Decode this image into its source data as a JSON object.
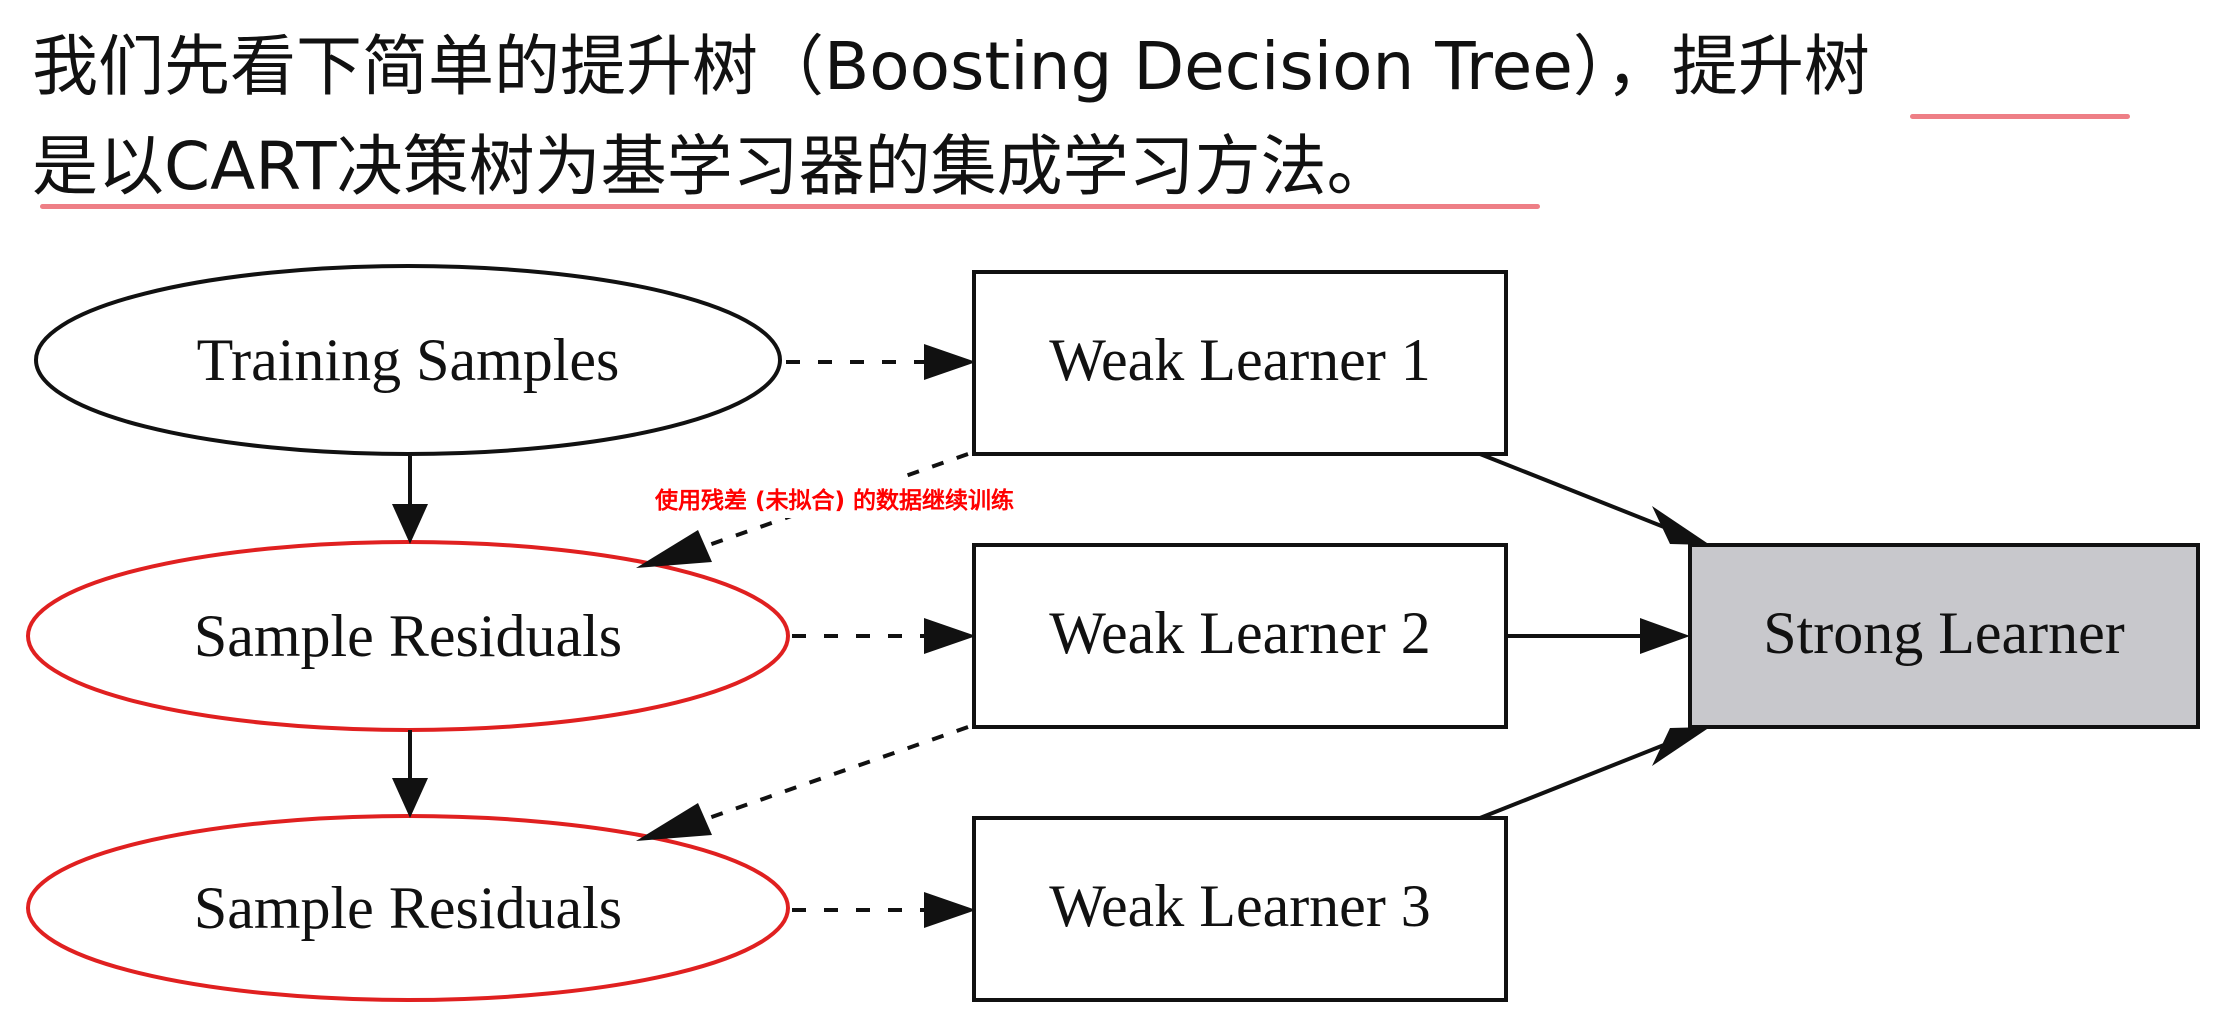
{
  "heading": {
    "line1_main": "我们先看下简单的提升树（Boosting Decision Tree），",
    "line1_highlight": "提升树",
    "line2": "是以CART决策树为基学习器的集成学习方法。"
  },
  "nodes": {
    "training_samples": "Training Samples",
    "residuals_1": "Sample Residuals",
    "residuals_2": "Sample Residuals",
    "weak_learner_1": "Weak Learner 1",
    "weak_learner_2": "Weak Learner 2",
    "weak_learner_3": "Weak Learner 3",
    "strong_learner": "Strong Learner"
  },
  "annotation": "使用残差 (未拟合) 的数据继续训练",
  "colors": {
    "residual_outline": "#e02020",
    "strong_fill": "#c8c8cc",
    "underline": "#ee7f86",
    "annotation": "#ff0000"
  }
}
